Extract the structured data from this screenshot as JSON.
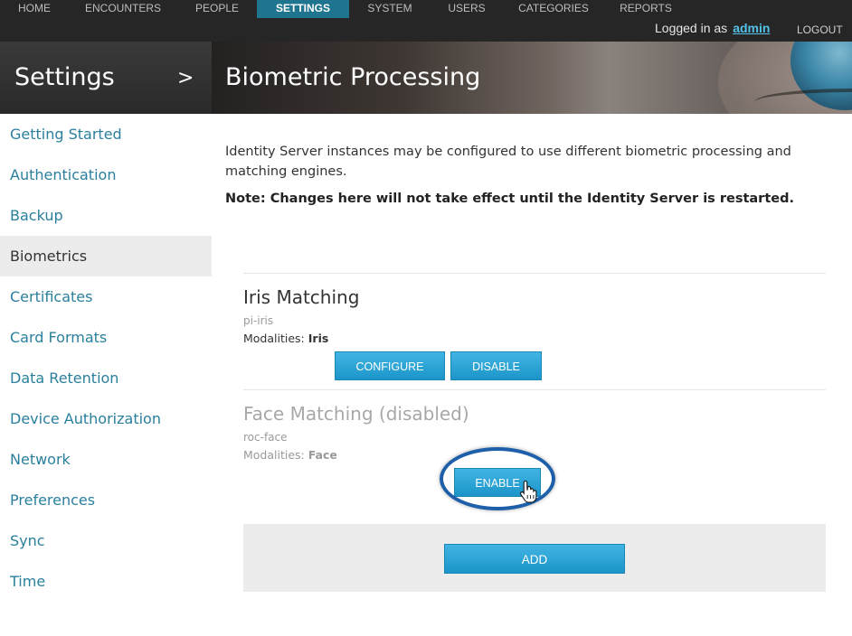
{
  "topnav": {
    "items": [
      {
        "label": "HOME",
        "active": false
      },
      {
        "label": "ENCOUNTERS",
        "active": false
      },
      {
        "label": "PEOPLE",
        "active": false
      },
      {
        "label": "SETTINGS",
        "active": true
      },
      {
        "label": "SYSTEM",
        "active": false
      },
      {
        "label": "USERS",
        "active": false
      },
      {
        "label": "CATEGORIES",
        "active": false
      },
      {
        "label": "REPORTS",
        "active": false
      }
    ],
    "logged_in_prefix": "Logged in as",
    "username": "admin",
    "logout_label": "LOGOUT"
  },
  "header": {
    "section": "Settings",
    "separator": ">",
    "page_title": "Biometric Processing"
  },
  "sidebar": {
    "items": [
      {
        "label": "Getting Started"
      },
      {
        "label": "Authentication"
      },
      {
        "label": "Backup"
      },
      {
        "label": "Biometrics",
        "active": true
      },
      {
        "label": "Certificates"
      },
      {
        "label": "Card Formats"
      },
      {
        "label": "Data Retention"
      },
      {
        "label": "Device Authorization"
      },
      {
        "label": "Network"
      },
      {
        "label": "Preferences"
      },
      {
        "label": "Sync"
      },
      {
        "label": "Time"
      }
    ]
  },
  "main": {
    "intro": "Identity Server instances may be configured to use different biometric processing and matching engines.",
    "note": "Note: Changes here will not take effect until the Identity Server is restarted.",
    "engines": [
      {
        "title": "Iris Matching",
        "id": "pi-iris",
        "modalities_label": "Modalities:",
        "modalities": "Iris",
        "buttons": {
          "configure": "CONFIGURE",
          "disable": "DISABLE"
        }
      },
      {
        "title": "Face Matching (disabled)",
        "id": "roc-face",
        "modalities_label": "Modalities:",
        "modalities": "Face",
        "buttons": {
          "enable": "ENABLE"
        }
      }
    ],
    "add_label": "ADD"
  },
  "colors": {
    "accent": "#2a7f9d",
    "nav_active": "#1f7590",
    "button": "#1c95c9",
    "highlight_ring": "#1d5fa8"
  }
}
